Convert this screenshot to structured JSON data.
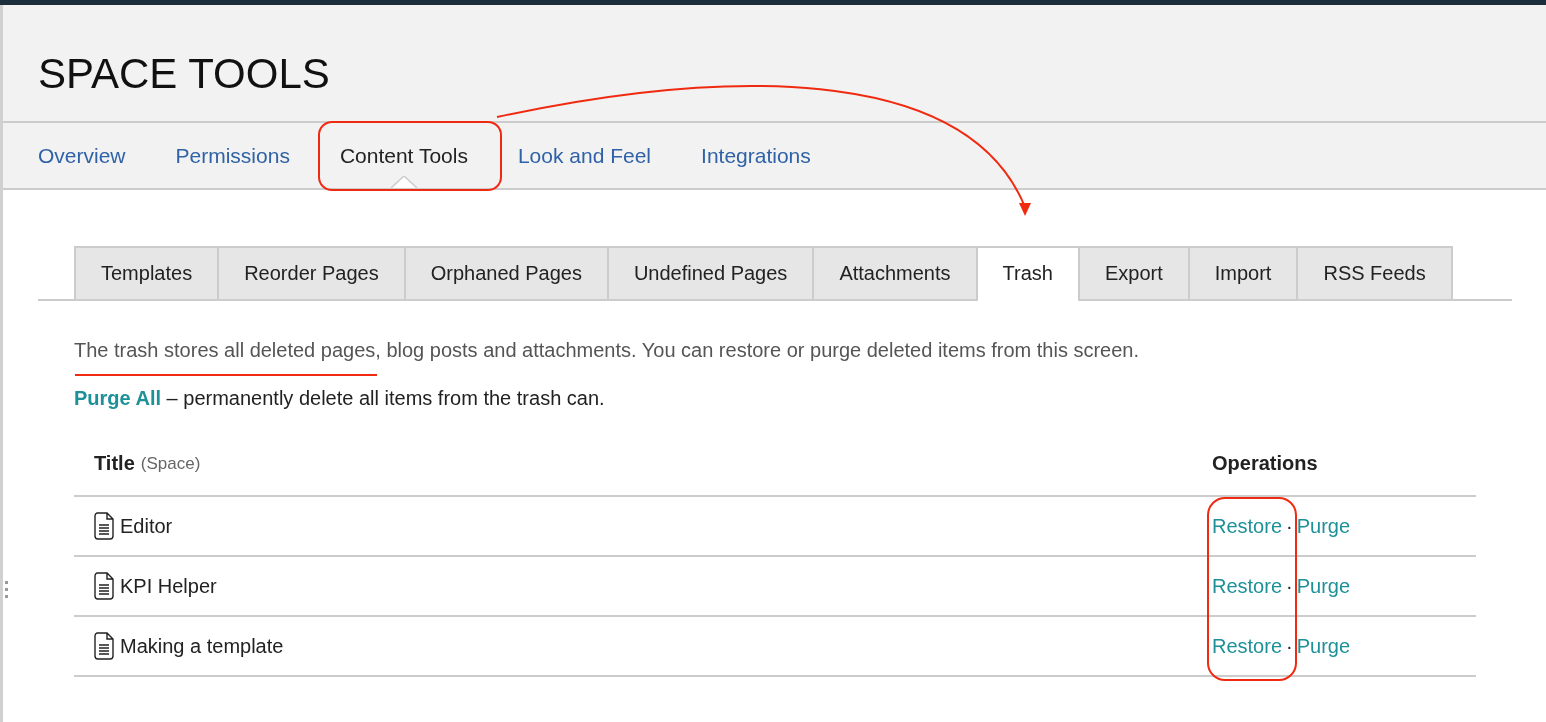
{
  "header": {
    "title": "SPACE TOOLS"
  },
  "nav_tabs": [
    {
      "label": "Overview",
      "selected": false
    },
    {
      "label": "Permissions",
      "selected": false
    },
    {
      "label": "Content Tools",
      "selected": true
    },
    {
      "label": "Look and Feel",
      "selected": false
    },
    {
      "label": "Integrations",
      "selected": false
    }
  ],
  "sub_tabs": [
    {
      "label": "Templates",
      "selected": false
    },
    {
      "label": "Reorder Pages",
      "selected": false
    },
    {
      "label": "Orphaned Pages",
      "selected": false
    },
    {
      "label": "Undefined Pages",
      "selected": false
    },
    {
      "label": "Attachments",
      "selected": false
    },
    {
      "label": "Trash",
      "selected": true
    },
    {
      "label": "Export",
      "selected": false
    },
    {
      "label": "Import",
      "selected": false
    },
    {
      "label": "RSS Feeds",
      "selected": false
    }
  ],
  "description": "The trash stores all deleted pages, blog posts and attachments. You can restore or purge deleted items from this screen.",
  "purge_all": {
    "link": "Purge All",
    "text": "– permanently delete all items from the trash can."
  },
  "table": {
    "columns": [
      {
        "label": "Title",
        "note": "(Space)"
      },
      {
        "label": "Operations"
      }
    ],
    "rows": [
      {
        "title": "Editor",
        "restore": "Restore",
        "separator": "·",
        "purge": "Purge"
      },
      {
        "title": "KPI Helper",
        "restore": "Restore",
        "separator": "·",
        "purge": "Purge"
      },
      {
        "title": "Making a template",
        "restore": "Restore",
        "separator": "·",
        "purge": "Purge"
      }
    ]
  }
}
